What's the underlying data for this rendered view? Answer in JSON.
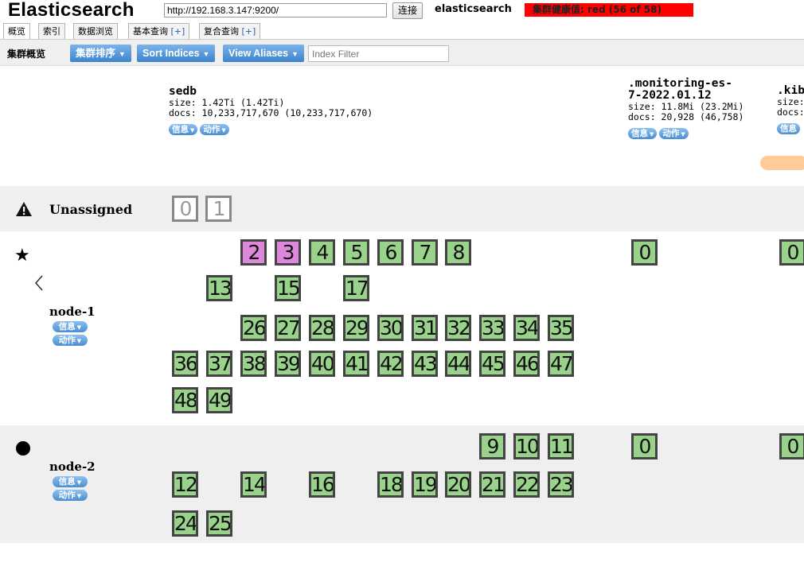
{
  "header": {
    "title": "Elasticsearch",
    "url": "http://192.168.3.147:9200/",
    "connect_label": "连接",
    "cluster_name": "elasticsearch",
    "health": "集群健康值: red (56 of 58)"
  },
  "tabs": [
    {
      "label": "概览"
    },
    {
      "label": "索引"
    },
    {
      "label": "数据浏览"
    },
    {
      "label": "基本查询",
      "plus": "[+]"
    },
    {
      "label": "复合查询",
      "plus": "[+]"
    }
  ],
  "toolbar": {
    "title": "集群概览",
    "sort_cluster": "集群排序",
    "sort_indices": "Sort Indices",
    "view_aliases": "View Aliases",
    "index_filter_placeholder": "Index Filter"
  },
  "pills": {
    "info": "信息",
    "action": "动作"
  },
  "indices": [
    {
      "name": "sedb",
      "size": "size: 1.42Ti (1.42Ti)",
      "docs": "docs: 10,233,717,670 (10,233,717,670)"
    },
    {
      "name_line1": ".monitoring-es-",
      "name_line2": "7-2022.01.12",
      "size": "size: 11.8Mi (23.2Mi)",
      "docs": "docs: 20,928 (46,758)"
    },
    {
      "name": ".kib",
      "size": "size:",
      "docs": "docs:"
    }
  ],
  "unassigned": {
    "label": "Unassigned",
    "shards": [
      "0",
      "1"
    ]
  },
  "nodes": [
    {
      "name": "node-1"
    },
    {
      "name": "node-2"
    }
  ],
  "shards": {
    "node1_sedb": [
      "2",
      "3",
      "4",
      "5",
      "6",
      "7",
      "8",
      "13",
      "15",
      "17",
      "26",
      "27",
      "28",
      "29",
      "30",
      "31",
      "32",
      "33",
      "34",
      "35",
      "36",
      "37",
      "38",
      "39",
      "40",
      "41",
      "42",
      "43",
      "44",
      "45",
      "46",
      "47",
      "48",
      "49"
    ],
    "node1_monitoring": "0",
    "node1_kibana": "0",
    "node2_sedb": [
      "9",
      "10",
      "11",
      "12",
      "14",
      "16",
      "18",
      "19",
      "20",
      "21",
      "22",
      "23",
      "24",
      "25"
    ],
    "node2_monitoring": "0",
    "node2_kibana": "0"
  },
  "colors": {
    "health_red": "#ff0000",
    "shard_started": "#99d38b",
    "shard_relocating": "#dd88dd",
    "button_blue": "#4a8fd2"
  }
}
